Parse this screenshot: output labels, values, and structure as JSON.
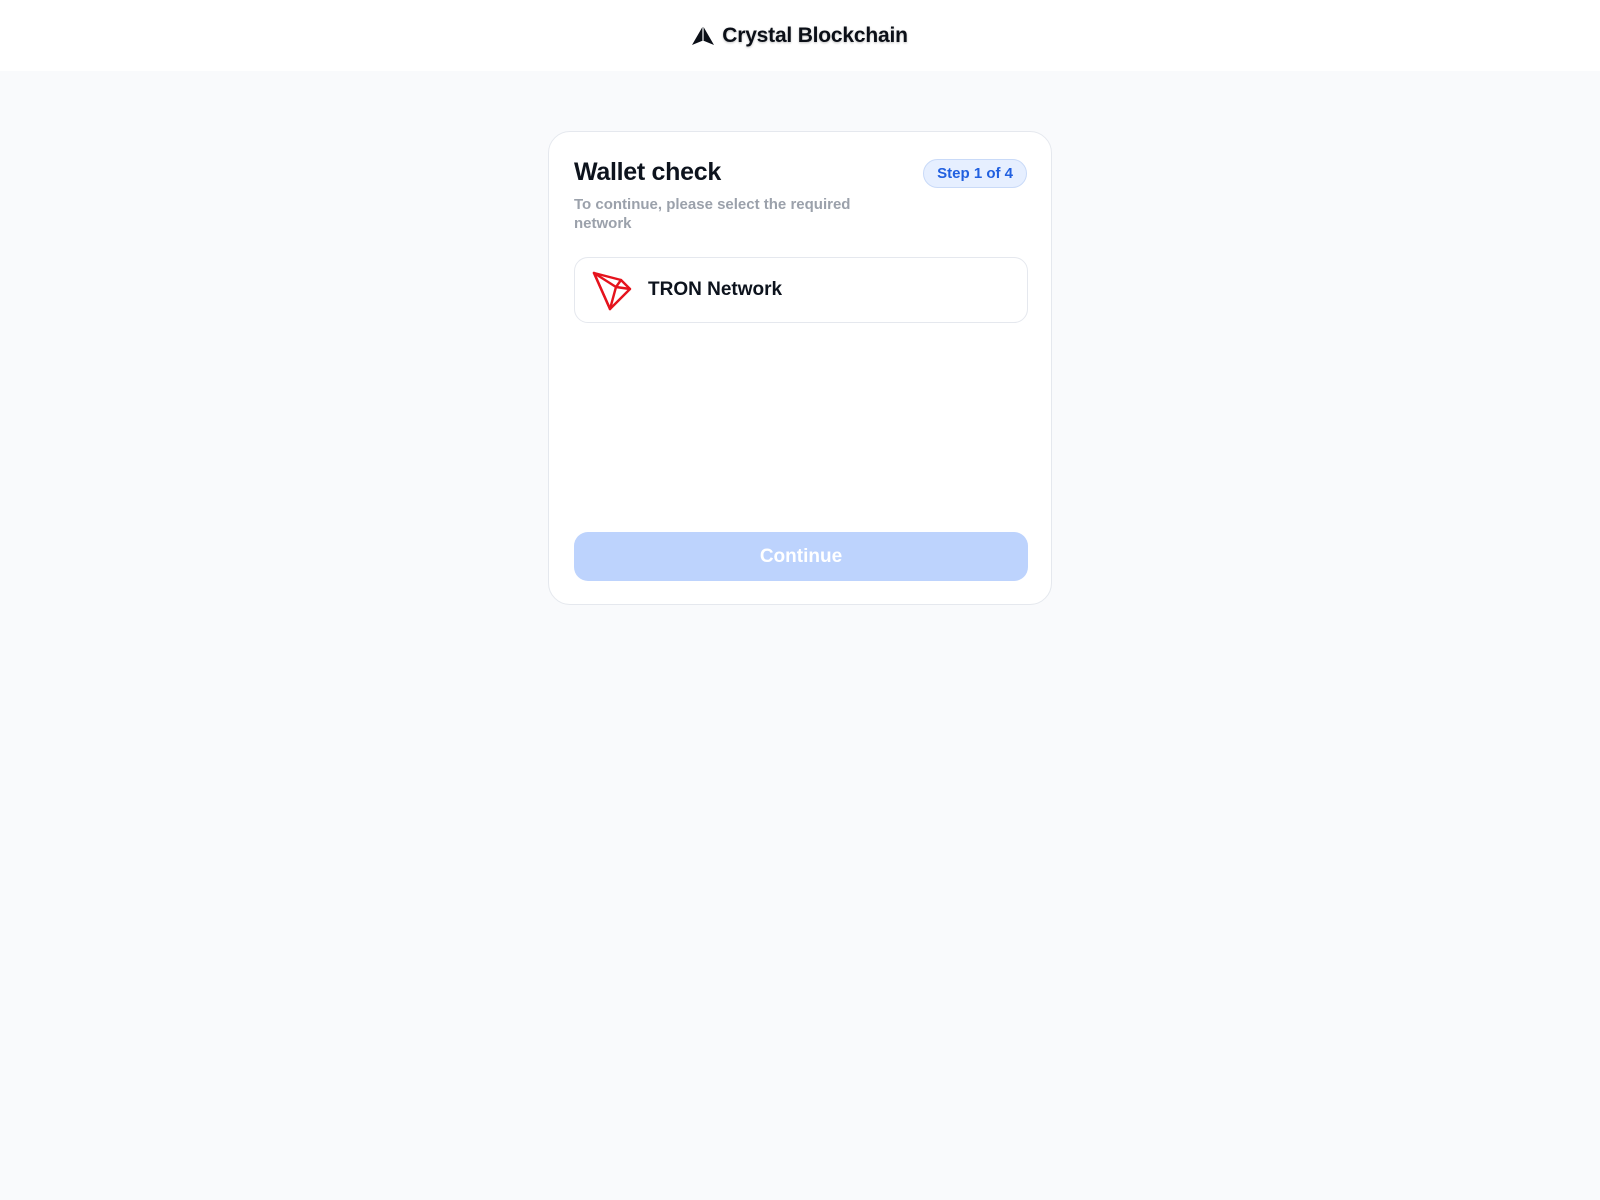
{
  "header": {
    "brand_name": "Crystal Blockchain",
    "brand_icon": "crystal-logo-icon"
  },
  "wallet_check": {
    "title": "Wallet check",
    "step_badge": "Step 1 of 4",
    "subtitle": "To continue, please select the required network",
    "networks": [
      {
        "name": "TRON Network",
        "icon": "tron-logo-icon",
        "color": "#e5131d"
      }
    ],
    "continue_label": "Continue"
  },
  "colors": {
    "accent": "#2160e0",
    "button_disabled": "#bdd3fd",
    "page_background": "#f9fafc",
    "tron_red": "#e5131d"
  }
}
